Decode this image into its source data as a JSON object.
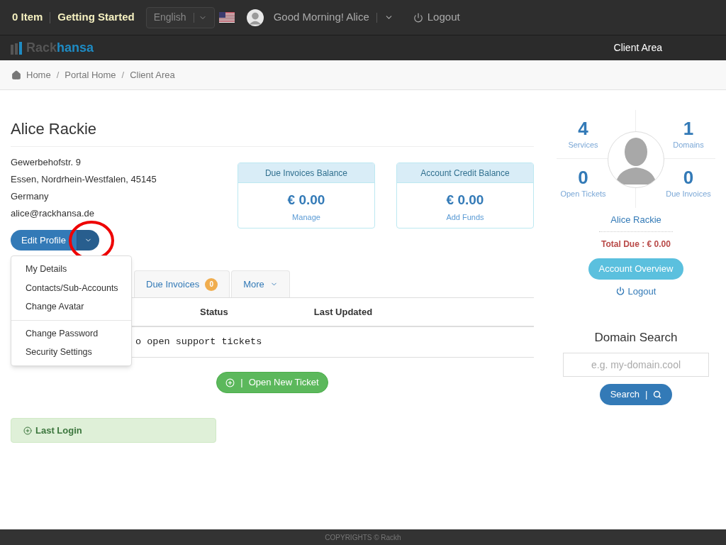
{
  "topbar": {
    "cart": "0 Item",
    "getting_started": "Getting Started",
    "language": {
      "value": "English"
    },
    "greeting": "Good Morning! Alice",
    "logout": "Logout"
  },
  "brand": {
    "logo_first": "Rack",
    "logo_second": "hansa",
    "nav": [
      "Client Area"
    ]
  },
  "breadcrumb": [
    "Home",
    "Portal Home",
    "Client Area"
  ],
  "breadcrumb_separator": "/",
  "button_separator": "|",
  "profile": {
    "name": "Alice Rackie",
    "address_lines": [
      "Gewerbehofstr. 9",
      "Essen, Nordrhein-Westfalen, 45145",
      "Germany",
      "alice@rackhansa.de"
    ],
    "edit_button": "Edit Profile",
    "menu": {
      "expanded": true,
      "groups": [
        [
          "My Details",
          "Contacts/Sub-Accounts",
          "Change Avatar"
        ],
        [
          "Change Password",
          "Security Settings"
        ]
      ]
    }
  },
  "balances": [
    {
      "title": "Due Invoices Balance",
      "amount": "€ 0.00",
      "link": "Manage"
    },
    {
      "title": "Account Credit Balance",
      "amount": "€ 0.00",
      "link": "Add Funds"
    }
  ],
  "tabs": [
    {
      "label": "Due Invoices",
      "badge": "0",
      "selected": false
    },
    {
      "label": "More",
      "selected": false
    }
  ],
  "table": {
    "columns": [
      "Status",
      "Last Updated"
    ],
    "empty_message": "o open support tickets"
  },
  "open_ticket_button": "Open New Ticket",
  "last_login": "Last Login",
  "sidebar": {
    "stats": [
      {
        "value": "4",
        "label": "Services"
      },
      {
        "value": "1",
        "label": "Domains"
      },
      {
        "value": "0",
        "label": "Open Tickets"
      },
      {
        "value": "0",
        "label": "Due Invoices"
      }
    ],
    "name": "Alice Rackie",
    "total_due": "Total Due : € 0.00",
    "overview_button": "Account Overview",
    "logout": "Logout",
    "domain_search": {
      "title": "Domain Search",
      "placeholder": "e.g. my-domain.cool",
      "button": "Search"
    }
  },
  "footer": "COPYRIGHTS © Rackh"
}
